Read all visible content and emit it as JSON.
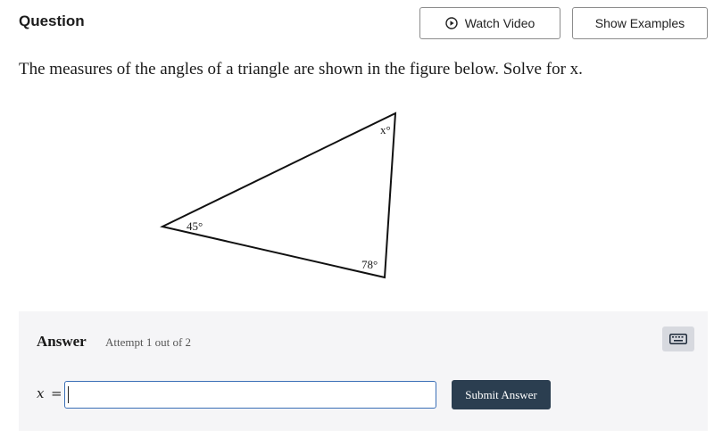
{
  "header": {
    "title": "Question",
    "watch_video_label": "Watch Video",
    "show_examples_label": "Show Examples"
  },
  "question": {
    "prompt": "The measures of the angles of a triangle are shown in the figure below. Solve for x."
  },
  "figure": {
    "angles": {
      "top": "x°",
      "left": "45°",
      "bottom": "78°"
    }
  },
  "answer": {
    "label": "Answer",
    "attempt": "Attempt 1 out of 2",
    "variable": "x",
    "equals": "=",
    "input_value": "",
    "submit_label": "Submit Answer"
  },
  "icons": {
    "watch_video": "play-circle-icon",
    "keyboard": "keyboard-icon"
  },
  "colors": {
    "submit_bg": "#2b3e50",
    "input_border": "#3b6fb6",
    "panel_bg": "#f5f5f7"
  }
}
